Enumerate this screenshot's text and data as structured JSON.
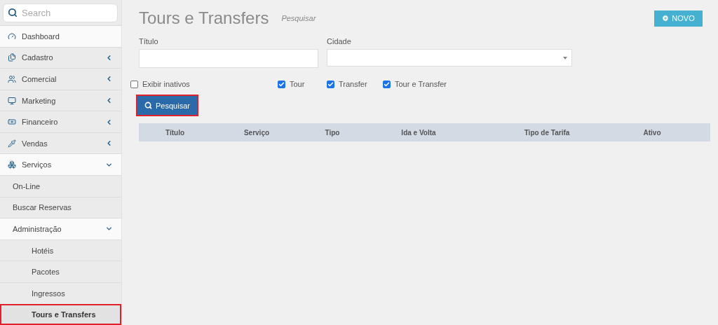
{
  "sidebar": {
    "search": {
      "placeholder": "Search"
    },
    "items": [
      {
        "label": "Dashboard",
        "kind": "link",
        "selected": false
      },
      {
        "label": "Cadastro",
        "kind": "menu",
        "expanded": false,
        "selected": false
      },
      {
        "label": "Comercial",
        "kind": "menu",
        "expanded": false,
        "selected": false
      },
      {
        "label": "Marketing",
        "kind": "menu",
        "expanded": false,
        "selected": false
      },
      {
        "label": "Financeiro",
        "kind": "menu",
        "expanded": false,
        "selected": false
      },
      {
        "label": "Vendas",
        "kind": "menu",
        "expanded": false,
        "selected": false
      },
      {
        "label": "Serviços",
        "kind": "menu",
        "expanded": true,
        "selected": false,
        "children": [
          {
            "label": "On-Line",
            "kind": "link",
            "selected": false
          },
          {
            "label": "Buscar Reservas",
            "kind": "link",
            "selected": false
          },
          {
            "label": "Administração",
            "kind": "menu",
            "expanded": true,
            "selected": false,
            "children": [
              {
                "label": "Hotéis",
                "selected": false
              },
              {
                "label": "Pacotes",
                "selected": false
              },
              {
                "label": "Ingressos",
                "selected": false
              },
              {
                "label": "Tours e Transfers",
                "selected": true
              }
            ]
          }
        ]
      }
    ]
  },
  "header": {
    "title": "Tours e Transfers",
    "subtitle": "Pesquisar",
    "new_button": "NOVO"
  },
  "fields": [
    {
      "label": "Título",
      "kind": "text"
    },
    {
      "label": "Cidade",
      "kind": "select"
    }
  ],
  "checkboxes": [
    {
      "label": "Exibir inativos",
      "checked": false
    },
    {
      "label": "Tour",
      "checked": true
    },
    {
      "label": "Transfer",
      "checked": true
    },
    {
      "label": "Tour e Transfer",
      "checked": true
    }
  ],
  "search_button": {
    "label": "Pesquisar",
    "highlighted": true
  },
  "table": {
    "columns": [
      "Título",
      "Serviço",
      "Tipo",
      "Ida e Volta",
      "Tipo de Tarifa",
      "Ativo"
    ]
  }
}
